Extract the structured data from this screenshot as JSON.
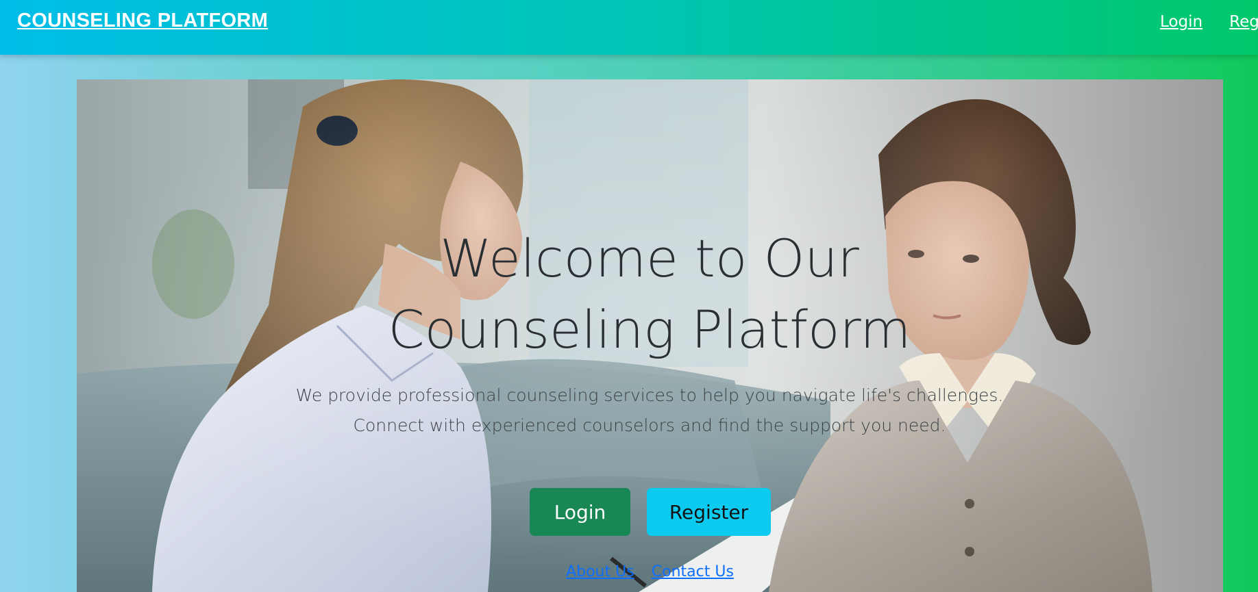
{
  "navbar": {
    "brand": "COUNSELING PLATFORM",
    "links": [
      "Login",
      "Register"
    ]
  },
  "hero": {
    "image_desc": "counseling-session-photo",
    "title": "Welcome to Our Counseling Platform",
    "text": "We provide professional counseling services to help you navigate life's challenges. Connect with experienced counselors and find the support you need.",
    "buttons": {
      "login": "Login",
      "register": "Register"
    },
    "footer_links": [
      "About Us",
      "Contact Us"
    ]
  },
  "colors": {
    "navbar_start": "#00bde8",
    "navbar_end": "#00c86a",
    "login_button": "#198754",
    "register_button": "#0dcaf0",
    "link": "#0d6efd"
  }
}
